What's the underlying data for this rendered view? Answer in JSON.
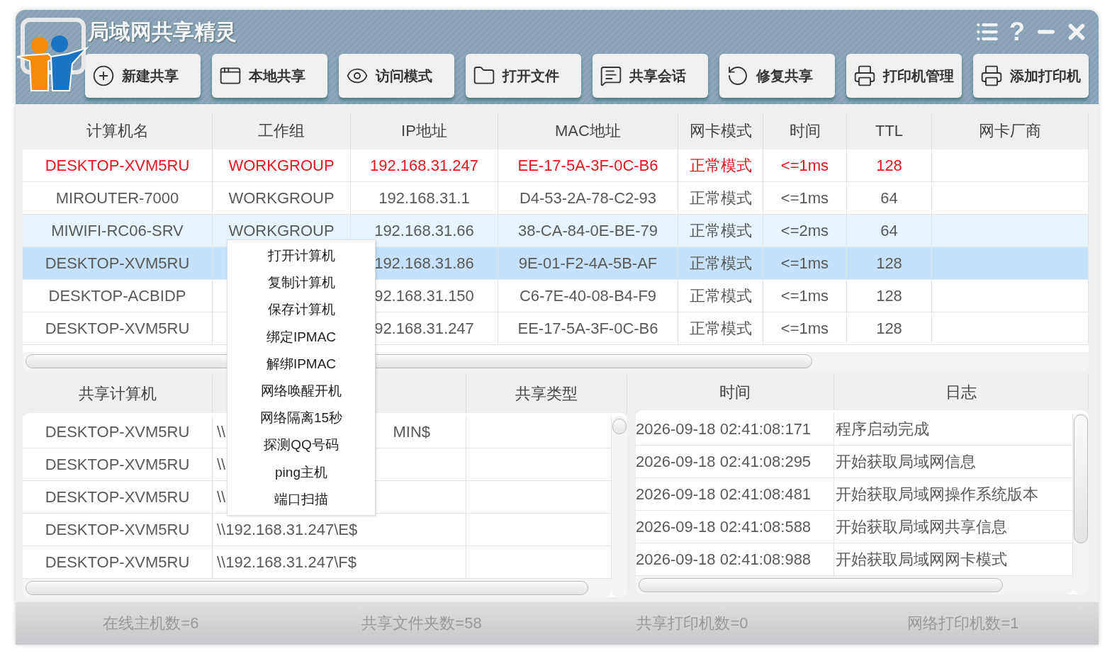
{
  "window": {
    "title": "局域网共享精灵",
    "help": "?"
  },
  "toolbar": [
    {
      "label": "新建共享"
    },
    {
      "label": "本地共享"
    },
    {
      "label": "访问模式"
    },
    {
      "label": "打开文件"
    },
    {
      "label": "共享会话"
    },
    {
      "label": "修复共享"
    },
    {
      "label": "打印机管理"
    },
    {
      "label": "添加打印机"
    }
  ],
  "hosts": {
    "columns": [
      "计算机名",
      "工作组",
      "IP地址",
      "MAC地址",
      "网卡模式",
      "时间",
      "TTL",
      "网卡厂商"
    ],
    "rows": [
      {
        "cells": [
          "DESKTOP-XVM5RU",
          "WORKGROUP",
          "192.168.31.247",
          "EE-17-5A-3F-0C-B6",
          "正常模式",
          "<=1ms",
          "128"
        ],
        "color": "#e8141c",
        "selected": false,
        "hovered": false
      },
      {
        "cells": [
          "MIROUTER-7000",
          "WORKGROUP",
          "192.168.31.1",
          "D4-53-2A-78-C2-93",
          "正常模式",
          "<=1ms",
          "64"
        ],
        "color": "#595959",
        "selected": false,
        "hovered": false
      },
      {
        "cells": [
          "MIWIFI-RC06-SRV",
          "WORKGROUP",
          "192.168.31.66",
          "38-CA-84-0E-BE-79",
          "正常模式",
          "<=2ms",
          "64"
        ],
        "color": "#595959",
        "selected": false,
        "hovered": true
      },
      {
        "cells": [
          "DESKTOP-XVM5RU",
          "",
          "192.168.31.86",
          "9E-01-F2-4A-5B-AF",
          "正常模式",
          "<=1ms",
          "128"
        ],
        "color": "#595959",
        "selected": true,
        "hovered": false
      },
      {
        "cells": [
          "DESKTOP-ACBIDP",
          "",
          "92.168.31.150",
          "C6-7E-40-08-B4-F9",
          "正常模式",
          "<=1ms",
          "128"
        ],
        "color": "#595959",
        "selected": false,
        "hovered": false
      },
      {
        "cells": [
          "DESKTOP-XVM5RU",
          "",
          "92.168.31.247",
          "EE-17-5A-3F-0C-B6",
          "正常模式",
          "<=1ms",
          "128"
        ],
        "color": "#595959",
        "selected": false,
        "hovered": false
      }
    ]
  },
  "context_menu": [
    "打开计算机",
    "复制计算机",
    "保存计算机",
    "绑定IPMAC",
    "解绑IPMAC",
    "网络唤醒开机",
    "网络隔离15秒",
    "探测QQ号码",
    "ping主机",
    "端口扫描"
  ],
  "shares": {
    "columns": [
      "共享计算机",
      "",
      "共享类型"
    ],
    "rows": [
      {
        "computer": "DESKTOP-XVM5RU",
        "path": "\\\\",
        "path_tail": "MIN$"
      },
      {
        "computer": "DESKTOP-XVM5RU",
        "path": "\\\\"
      },
      {
        "computer": "DESKTOP-XVM5RU",
        "path": "\\\\"
      },
      {
        "computer": "DESKTOP-XVM5RU",
        "path": "\\\\192.168.31.247\\E$"
      },
      {
        "computer": "DESKTOP-XVM5RU",
        "path": "\\\\192.168.31.247\\F$"
      }
    ]
  },
  "log": {
    "columns": [
      "时间",
      "日志"
    ],
    "rows": [
      {
        "time": "2026-09-18 02:41:08:171",
        "message": "程序启动完成"
      },
      {
        "time": "2026-09-18 02:41:08:295",
        "message": "开始获取局域网信息"
      },
      {
        "time": "2026-09-18 02:41:08:481",
        "message": "开始获取局域网操作系统版本"
      },
      {
        "time": "2026-09-18 02:41:08:588",
        "message": "开始获取局域网共享信息"
      },
      {
        "time": "2026-09-18 02:41:08:988",
        "message": "开始获取局域网网卡模式"
      }
    ]
  },
  "status_bar": [
    "在线主机数=6",
    "共享文件夹数=58",
    "共享打印机数=0",
    "网络打印机数=1"
  ]
}
